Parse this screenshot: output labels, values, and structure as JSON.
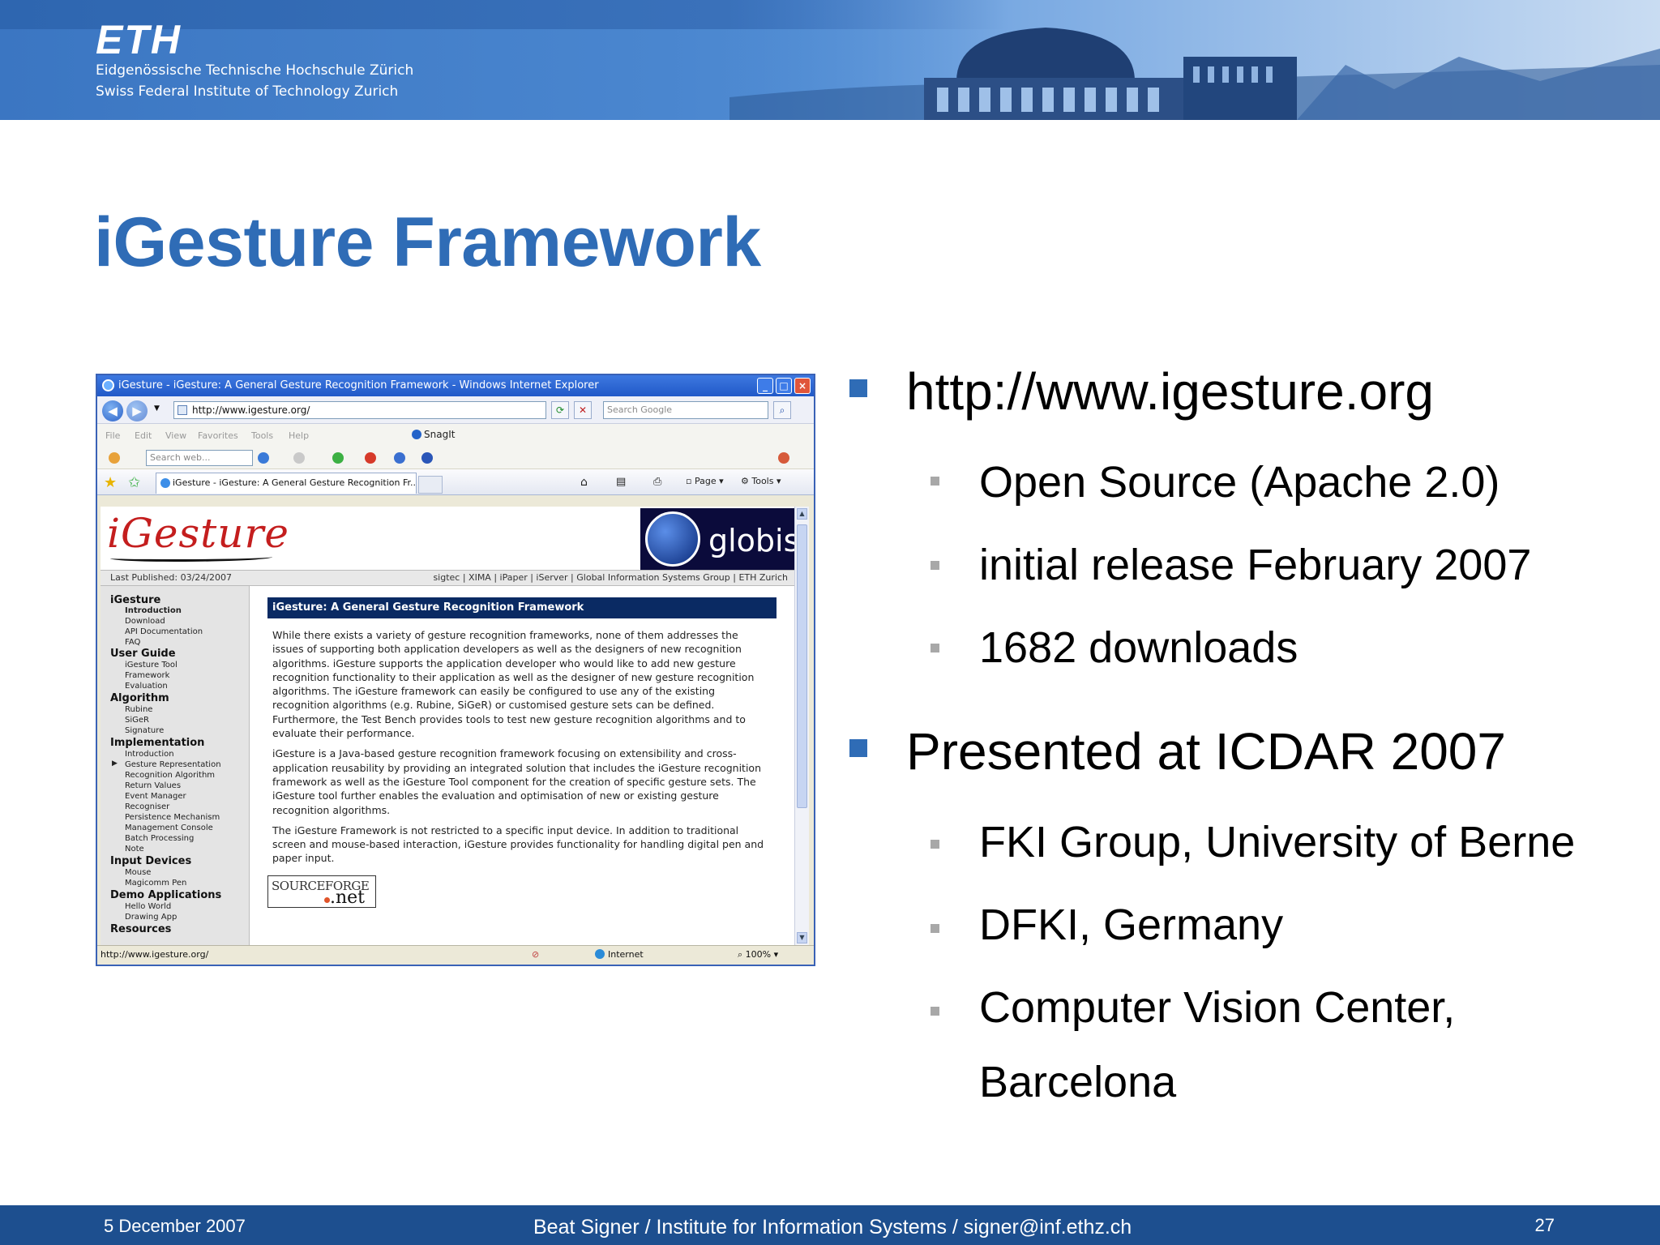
{
  "header": {
    "logo": "ETH",
    "line1": "Eidgenössische Technische Hochschule Zürich",
    "line2": "Swiss Federal Institute of Technology Zurich"
  },
  "slide": {
    "title": "iGesture Framework"
  },
  "browser": {
    "window_title": "iGesture - iGesture: A General Gesture Recognition Framework - Windows Internet Explorer",
    "address": "http://www.igesture.org/",
    "search_placeholder": "Search Google",
    "menu": [
      "File",
      "Edit",
      "View",
      "Favorites",
      "Tools",
      "Help"
    ],
    "snagit": "SnagIt",
    "web_search_placeholder": "Search web...",
    "tab_title": "iGesture - iGesture: A General Gesture Recognition Fr...",
    "toolbar_page": "Page",
    "toolbar_tools": "Tools",
    "status_url": "http://www.igesture.org/",
    "status_zone": "Internet",
    "status_zoom": "100%",
    "page": {
      "logo": "iGesture",
      "globis": "globis",
      "last_published": "Last Published: 03/24/2007",
      "top_links": "sigtec | XIMA | iPaper | iServer | Global Information Systems Group | ETH Zurich",
      "nav": {
        "igesture": "iGesture",
        "introduction": "Introduction",
        "download": "Download",
        "api_doc": "API Documentation",
        "faq": "FAQ",
        "user_guide": "User Guide",
        "igesture_tool": "iGesture Tool",
        "framework": "Framework",
        "evaluation": "Evaluation",
        "algorithm": "Algorithm",
        "rubine": "Rubine",
        "siger": "SiGeR",
        "signature": "Signature",
        "implementation": "Implementation",
        "impl_intro": "Introduction",
        "gesture_rep": "Gesture Representation",
        "recog_algo": "Recognition Algorithm",
        "return_values": "Return Values",
        "event_manager": "Event Manager",
        "recogniser": "Recogniser",
        "persistence": "Persistence Mechanism",
        "mgmt_console": "Management Console",
        "batch": "Batch Processing",
        "note": "Note",
        "input_devices": "Input Devices",
        "mouse": "Mouse",
        "magicomm": "Magicomm Pen",
        "demo_apps": "Demo Applications",
        "hello_world": "Hello World",
        "drawing_app": "Drawing App",
        "resources": "Resources"
      },
      "content_heading": "iGesture: A General Gesture Recognition Framework",
      "para1": "While there exists a variety of gesture recognition frameworks, none of them addresses the issues of supporting both application developers as well as the designers of new recognition algorithms. iGesture supports the application developer who would like to add new gesture recognition functionality to their application as well as the designer of new gesture recognition algorithms. The iGesture framework can easily be configured to use any of the existing recognition algorithms (e.g. Rubine, SiGeR) or customised gesture sets can be defined. Furthermore, the Test Bench provides tools to test new gesture recognition algorithms and to evaluate their performance.",
      "para2": "iGesture is a Java-based gesture recognition framework focusing on extensibility and cross-application reusability by providing an integrated solution that includes the iGesture recognition framework as well as the iGesture Tool component for the creation of specific gesture sets. The iGesture tool further enables the evaluation and optimisation of new or existing gesture recognition algorithms.",
      "para3": "The iGesture Framework is not restricted to a specific input device. In addition to traditional screen and mouse-based interaction, iGesture provides functionality for handling digital pen and paper input.",
      "sourceforge": "SOURCEFORGE",
      "sourceforge_net": ".net"
    }
  },
  "bullets": {
    "b1": "http://www.igesture.org",
    "b1_sub": [
      "Open Source (Apache 2.0)",
      "initial release February 2007",
      "1682 downloads"
    ],
    "b2": "Presented at ICDAR 2007",
    "b2_sub": [
      "FKI Group, University of Berne",
      "DFKI, Germany",
      "Computer Vision Center,",
      "Barcelona"
    ]
  },
  "footer": {
    "date": "5 December 2007",
    "center": "Beat Signer / Institute for Information Systems / signer@inf.ethz.ch",
    "page": "27"
  },
  "colors": {
    "title": "#2f6cb6",
    "footer": "#1d4f8f",
    "bullet_l1": "#2f6cb6",
    "bullet_l2": "#a8a8a8"
  }
}
